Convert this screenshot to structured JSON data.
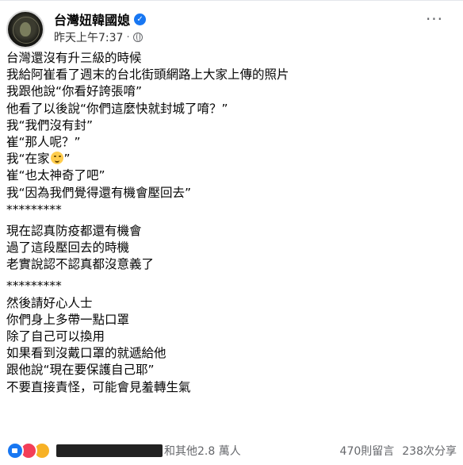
{
  "post": {
    "author": "台灣妞韓國媳",
    "time": "昨天上午7:37",
    "separator": "·",
    "more_label": "···",
    "lines_a": [
      "台灣還沒有升三級的時候",
      "我給阿崔看了週末的台北街頭網路上大家上傳的照片",
      "我跟他說“你看好誇張唷”",
      "他看了以後說“你們這麼快就封城了唷？”",
      "我“我們沒有封”",
      "崔“那人呢？”"
    ],
    "emoji_line": {
      "before": "我“在家",
      "after": "”"
    },
    "lines_b": [
      "崔“也太神奇了吧”",
      "我“因為我們覺得還有機會壓回去”",
      "*********"
    ],
    "lines_c": [
      "現在認真防疫都還有機會",
      "過了這段壓回去的時機",
      "老實說認不認真都沒意義了"
    ],
    "lines_d": [
      "*********",
      "然後請好心人士",
      "你們身上多帶一點口罩",
      "除了自己可以換用",
      "如果看到沒戴口罩的就遞給他",
      "跟他說“現在要保護自己耶”",
      "不要直接責怪，可能會見羞轉生氣"
    ]
  },
  "footer": {
    "reactions_text": "和其他2.8 萬人",
    "comments": "470則留言",
    "shares": "238次分享"
  },
  "colors": {
    "link_blue": "#1877f2",
    "secondary_text": "#65676b",
    "text": "#050505"
  },
  "icons": [
    "avatar",
    "verified-badge-icon",
    "globe-icon",
    "more-options-icon",
    "like-reaction-icon",
    "love-reaction-icon",
    "haha-reaction-icon",
    "smiling-emoji-icon"
  ]
}
